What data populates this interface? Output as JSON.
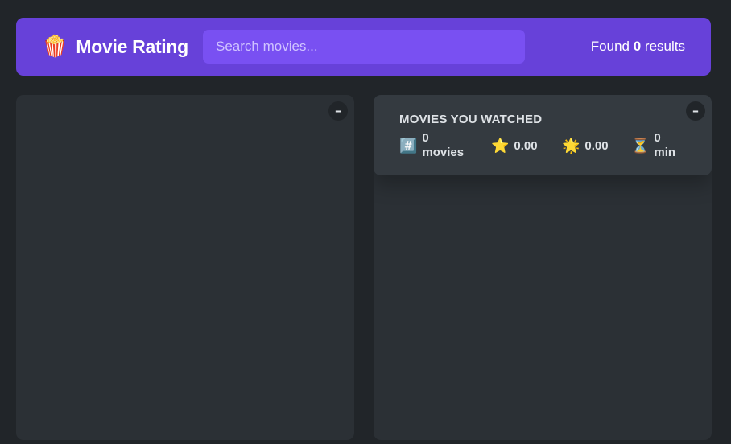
{
  "nav": {
    "logo_icon": "🍿",
    "logo_text": "Movie Rating",
    "search_placeholder": "Search movies...",
    "results_prefix": "Found",
    "results_count": "0",
    "results_suffix": "results"
  },
  "left_box": {
    "toggle_label": "–"
  },
  "right_box": {
    "toggle_label": "–",
    "summary": {
      "heading": "Movies you watched",
      "movies_icon": "#️⃣",
      "movies_count": "0",
      "movies_unit": "movies",
      "imdb_icon": "⭐️",
      "imdb_avg": "0.00",
      "user_icon": "🌟",
      "user_avg": "0.00",
      "runtime_icon": "⏳",
      "runtime_value": "0",
      "runtime_unit": "min"
    }
  },
  "colors": {
    "primary": "#6741d9",
    "primary_light": "#7950f2",
    "background": "#212529",
    "box": "#2b3035",
    "summary": "#343a40"
  }
}
